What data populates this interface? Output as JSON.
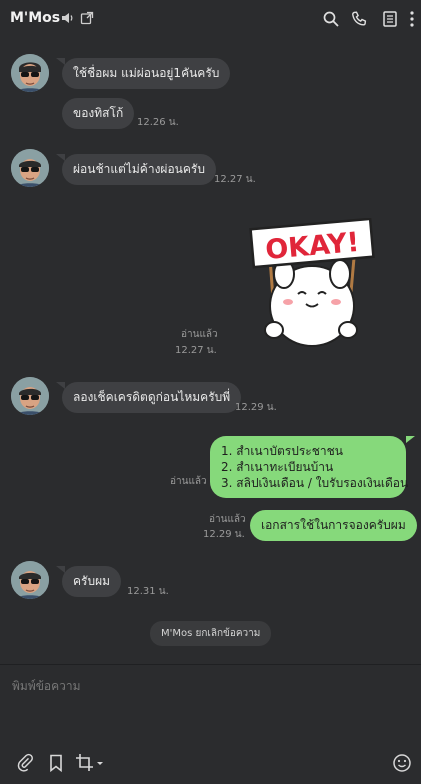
{
  "header": {
    "title": "M'Mos"
  },
  "messages": [
    {
      "type": "in",
      "text": "ใช้ชื่อผม แม่ผ่อนอยู่1คันครับ"
    },
    {
      "type": "in",
      "text": "ของทิสโก้",
      "time": "12.26 น."
    },
    {
      "type": "in",
      "text": "ผ่อนช้าแต่ไม่ค้างผ่อนครับ",
      "time": "12.27 น."
    },
    {
      "type": "sticker",
      "text": "OKAY!",
      "read": "อ่านแล้ว",
      "time": "12.27 น."
    },
    {
      "type": "in",
      "text": "ลองเช็คเครดิตดูก่อนไหมครับพี่",
      "time": "12.29 น."
    },
    {
      "type": "out",
      "lines": [
        "1. สำเนาบัตรประชาชน",
        "2. สำเนาทะเบียนบ้าน",
        "3. สลิปเงินเดือน / ใบรับรองเงินเดือน"
      ],
      "read": "อ่านแล้ว"
    },
    {
      "type": "out",
      "text": "เอกสารใช้ในการจองครับผม",
      "read": "อ่านแล้ว",
      "time": "12.29 น."
    },
    {
      "type": "in",
      "text": "ครับผม",
      "time": "12.31 น."
    },
    {
      "type": "system",
      "text": "M'Mos ยกเลิกข้อความ"
    }
  ],
  "input": {
    "placeholder": "พิมพ์ข้อความ"
  },
  "icons": {
    "header": [
      "speaker-icon",
      "external-window-icon",
      "search-icon",
      "phone-icon",
      "notes-icon",
      "more-vertical-icon"
    ],
    "toolbar": [
      "attach-icon",
      "bookmark-icon",
      "screenshot-crop-icon",
      "dropdown-caret-icon",
      "emoji-icon"
    ]
  },
  "colors": {
    "background": "#2b2c2e",
    "bubble_in": "#3f4043",
    "bubble_out": "#86d97b"
  }
}
